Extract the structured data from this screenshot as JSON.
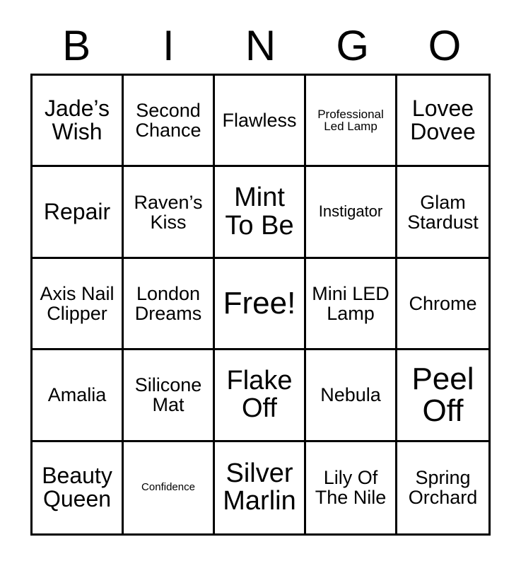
{
  "card": {
    "type": "bingo-card",
    "header_letters": [
      "B",
      "I",
      "N",
      "G",
      "O"
    ],
    "rows": 5,
    "columns": 5,
    "free_space": {
      "row": 3,
      "column": 3,
      "label": "Free!"
    },
    "colors": {
      "background": "#ffffff",
      "text": "#000000",
      "grid_line": "#000000"
    },
    "cells": [
      [
        {
          "text": "Jade’s Wish",
          "size": "md"
        },
        {
          "text": "Second Chance",
          "size": "sm"
        },
        {
          "text": "Flawless",
          "size": "sm"
        },
        {
          "text": "Professional Led Lamp",
          "size": "xxs"
        },
        {
          "text": "Lovee Dovee",
          "size": "md"
        }
      ],
      [
        {
          "text": "Repair",
          "size": "md"
        },
        {
          "text": "Raven’s Kiss",
          "size": "sm"
        },
        {
          "text": "Mint To Be",
          "size": "lg"
        },
        {
          "text": "Instigator",
          "size": "xs"
        },
        {
          "text": "Glam Stardust",
          "size": "sm"
        }
      ],
      [
        {
          "text": "Axis Nail Clipper",
          "size": "sm"
        },
        {
          "text": "London Dreams",
          "size": "sm"
        },
        {
          "text": "Free!",
          "size": "xl"
        },
        {
          "text": "Mini LED Lamp",
          "size": "sm"
        },
        {
          "text": "Chrome",
          "size": "sm"
        }
      ],
      [
        {
          "text": "Amalia",
          "size": "sm"
        },
        {
          "text": "Silicone Mat",
          "size": "sm"
        },
        {
          "text": "Flake Off",
          "size": "lg"
        },
        {
          "text": "Nebula",
          "size": "sm"
        },
        {
          "text": "Peel Off",
          "size": "xl"
        }
      ],
      [
        {
          "text": "Beauty Queen",
          "size": "md"
        },
        {
          "text": "Confidence",
          "size": "tiny"
        },
        {
          "text": "Silver Marlin",
          "size": "lg"
        },
        {
          "text": "Lily Of The Nile",
          "size": "sm"
        },
        {
          "text": "Spring Orchard",
          "size": "sm"
        }
      ]
    ]
  }
}
